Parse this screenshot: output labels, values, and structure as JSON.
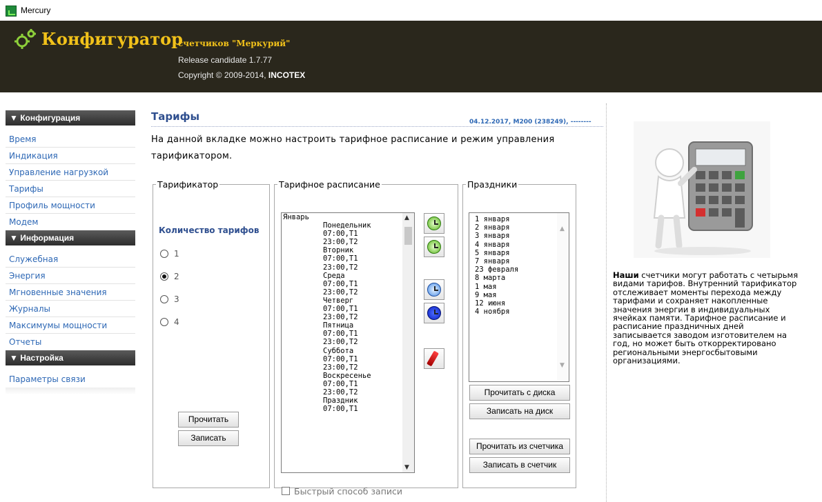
{
  "window": {
    "title": "Mercury"
  },
  "header": {
    "brand": "Конфигуратор",
    "subtitle": "счетчиков \"Меркурий\"",
    "release": "Release candidate 1.7.77",
    "copyright_prefix": "Copyright © 2009-2014, ",
    "copyright_company": "INCOTEX"
  },
  "sidebar": {
    "sections": [
      {
        "title": "▼ Конфигурация",
        "items": [
          "Время",
          "Индикация",
          "Управление нагрузкой",
          "Тарифы",
          "Профиль мощности",
          "Модем"
        ]
      },
      {
        "title": "▼ Информация",
        "items": [
          "Служебная",
          "Энергия",
          "Мгновенные значения",
          "Журналы",
          "Максимумы мощности",
          "Отчеты"
        ]
      },
      {
        "title": "▼ Настройка",
        "items": [
          "Параметры связи"
        ]
      }
    ]
  },
  "content": {
    "title": "Тарифы",
    "meta": "04.12.2017, M200 (238249), --------",
    "description": "На данной вкладке можно настроить тарифное расписание и режим управления тарификатором."
  },
  "tarifikator": {
    "legend": "Тарификатор",
    "count_label": "Количество тарифов",
    "options": [
      "1",
      "2",
      "3",
      "4"
    ],
    "selected": "2",
    "read_button": "Прочитать",
    "write_button": "Записать"
  },
  "schedule": {
    "legend": "Тарифное расписание",
    "lines": [
      {
        "text": "Январь",
        "indent": false
      },
      {
        "text": "Понедельник",
        "indent": true
      },
      {
        "text": "07:00,T1",
        "indent": true
      },
      {
        "text": "23:00,T2",
        "indent": true
      },
      {
        "text": "Вторник",
        "indent": true
      },
      {
        "text": "07:00,T1",
        "indent": true
      },
      {
        "text": "23:00,T2",
        "indent": true
      },
      {
        "text": "Среда",
        "indent": true
      },
      {
        "text": "07:00,T1",
        "indent": true
      },
      {
        "text": "23:00,T2",
        "indent": true
      },
      {
        "text": "Четверг",
        "indent": true
      },
      {
        "text": "07:00,T1",
        "indent": true
      },
      {
        "text": "23:00,T2",
        "indent": true
      },
      {
        "text": "Пятница",
        "indent": true
      },
      {
        "text": "07:00,T1",
        "indent": true
      },
      {
        "text": "23:00,T2",
        "indent": true
      },
      {
        "text": "Суббота",
        "indent": true
      },
      {
        "text": "07:00,T1",
        "indent": true
      },
      {
        "text": "23:00,T2",
        "indent": true
      },
      {
        "text": "Воскресенье",
        "indent": true
      },
      {
        "text": "07:00,T1",
        "indent": true
      },
      {
        "text": "23:00,T2",
        "indent": true
      },
      {
        "text": "Праздник",
        "indent": true
      },
      {
        "text": "07:00,T1",
        "indent": true
      }
    ],
    "fast_write_label": "Быстрый способ записи",
    "fast_write_checked": false,
    "icons": [
      "clock-green-icon",
      "clock-green-refresh-icon",
      "clock-blue-icon",
      "clock-darkblue-icon",
      "pencil-icon"
    ]
  },
  "holidays": {
    "legend": "Праздники",
    "items": [
      "1 января",
      "2 января",
      "3 января",
      "4 января",
      "5 января",
      "7 января",
      "23 февраля",
      "8 марта",
      "1 мая",
      "9 мая",
      "12 июня",
      "4 ноября"
    ],
    "read_disk": "Прочитать с диска",
    "write_disk": "Записать на диск",
    "read_meter": "Прочитать из счетчика",
    "write_meter": "Записать в счетчик"
  },
  "aside": {
    "lead": "Наши",
    "text": " счетчики могут работать с четырьмя видами тарифов. Внутренний тарификатор отслеживает моменты перехода между тарифами и сохраняет накопленные значения энергии в индивидуальных ячейках памяти. Тарифное расписание и расписание праздничных дней записывается заводом изготовителем на год, но может быть откорректировано региональными энергосбытовыми организациями."
  },
  "colors": {
    "header_bg": "#2a271c",
    "brand": "#f2c21a",
    "link": "#2e68b5",
    "title": "#2f4f8f"
  }
}
